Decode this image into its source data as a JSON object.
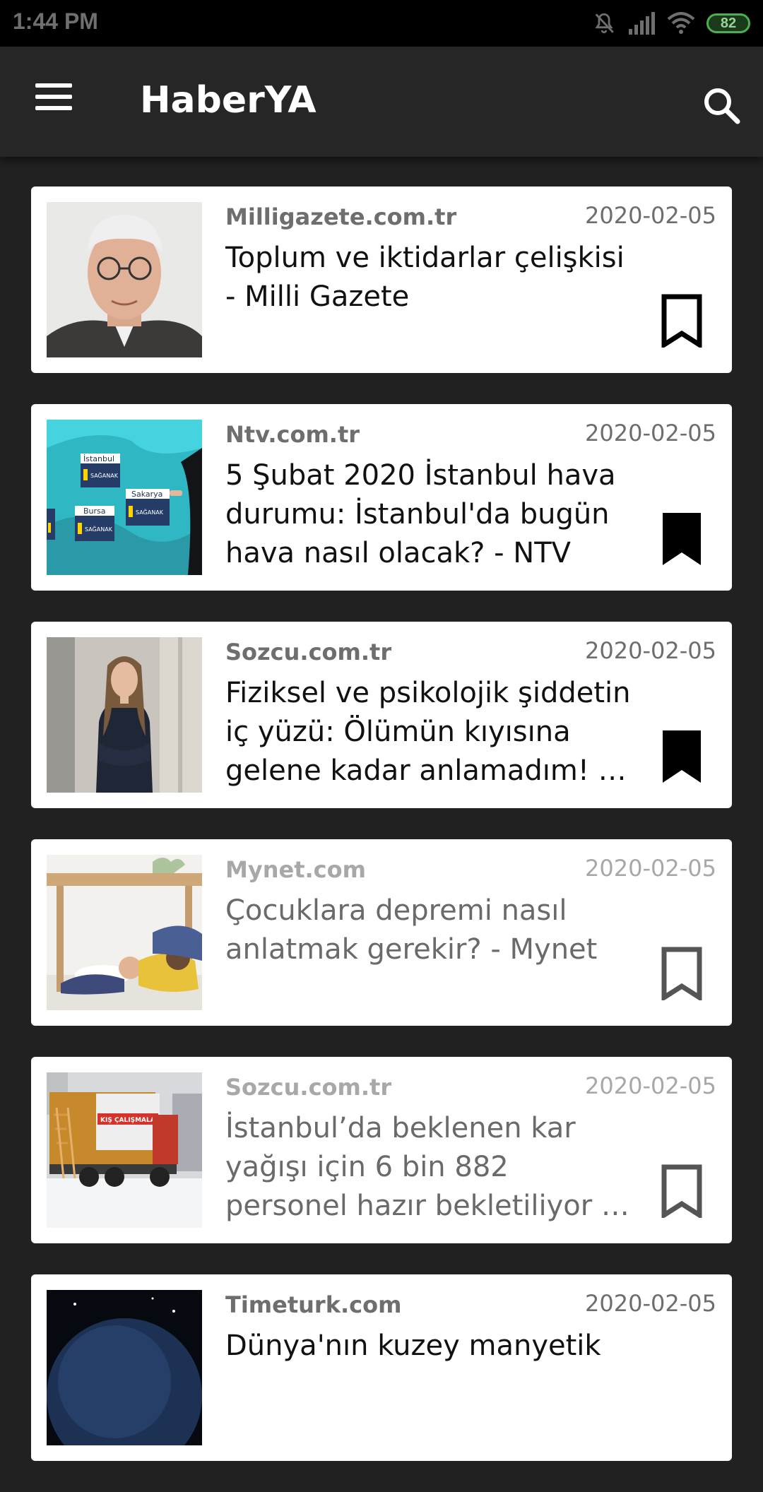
{
  "status_bar": {
    "time": "1:44 PM",
    "battery_level": "82",
    "icons": [
      "mute-icon",
      "signal-icon",
      "wifi-icon",
      "battery-icon"
    ]
  },
  "app_bar": {
    "title": "HaberYA",
    "menu_icon": "menu-icon",
    "search_icon": "search-icon"
  },
  "articles": [
    {
      "source": "Milligazete.com.tr",
      "date": "2020-02-05",
      "headline": "Toplum ve iktidarlar çelişkisi - Milli Gazete",
      "bookmarked": false,
      "read": false,
      "thumbnail": "portrait-photo"
    },
    {
      "source": "Ntv.com.tr",
      "date": "2020-02-05",
      "headline": "5 Şubat 2020 İstanbul hava durumu: İstanbul'da bugün hava nasıl olacak? - NTV",
      "bookmarked": true,
      "read": false,
      "thumbnail": "weather-map"
    },
    {
      "source": "Sozcu.com.tr",
      "date": "2020-02-05",
      "headline": "Fiziksel ve psikolojik şiddetin iç yüzü: Ölümün kıyısına gelene kadar anlamadım! - ...",
      "bookmarked": true,
      "read": false,
      "thumbnail": "woman-photo"
    },
    {
      "source": "Mynet.com",
      "date": "2020-02-05",
      "headline": "Çocuklara depremi nasıl anlatmak gerekir? - Mynet",
      "bookmarked": false,
      "read": true,
      "thumbnail": "children-photo"
    },
    {
      "source": "Sozcu.com.tr",
      "date": "2020-02-05",
      "headline": "İstanbul’da beklenen kar yağışı için 6 bin 882 personel hazır bekletiliyor - Sözcü",
      "bookmarked": false,
      "read": true,
      "thumbnail": "snow-truck-photo"
    },
    {
      "source": "Timeturk.com",
      "date": "2020-02-05",
      "headline": "Dünya'nın kuzey manyetik",
      "bookmarked": false,
      "read": false,
      "thumbnail": "earth-photo"
    }
  ],
  "thumb_labels": {
    "istanbul": "İstanbul",
    "bursa": "Bursa",
    "sakarya": "Sakarya",
    "saganak": "SAĞANAK",
    "truck_banner": "KIŞ ÇALIŞMALARI"
  }
}
